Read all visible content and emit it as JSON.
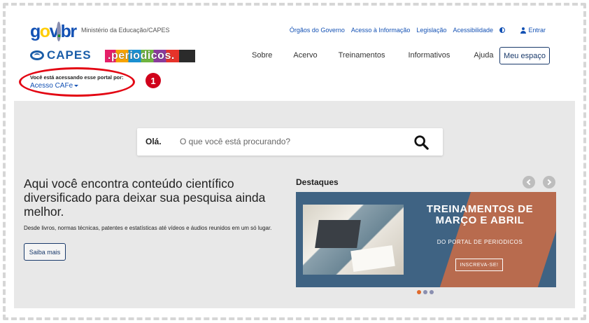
{
  "header": {
    "govbr_logo": "gov.br",
    "ministry": "Ministério da Educação/CAPES",
    "top_links": [
      "Órgãos do Governo",
      "Acesso à Informação",
      "Legislação",
      "Acessibilidade"
    ],
    "login": "Entrar"
  },
  "brand": {
    "capes": "CAPES",
    "periodicos": ".periodicos."
  },
  "nav": {
    "items": [
      "Sobre",
      "Acervo",
      "Treinamentos",
      "Informativos",
      "Ajuda"
    ],
    "my_space": "Meu espaço"
  },
  "access": {
    "label": "Você está acessando esse portal por:",
    "value": "Acesso CAFe",
    "annotation_number": "1"
  },
  "search": {
    "greeting": "Olá.",
    "placeholder": "O que você está procurando?"
  },
  "hero": {
    "headline": "Aqui você encontra conteúdo científico diversificado para deixar sua pesquisa ainda melhor.",
    "subtext": "Desde livros, normas técnicas, patentes e estatísticas até vídeos e áudios reunidos em um só lugar.",
    "cta": "Saiba mais"
  },
  "highlights": {
    "title": "Destaques",
    "banner_title": "TREINAMENTOS DE MARÇO E ABRIL",
    "banner_sub": "DO PORTAL DE PERIODICOS",
    "banner_button": "INSCREVA-SE!",
    "slide_count": 3,
    "active_slide": 1
  },
  "colors": {
    "primary_blue": "#1351b4",
    "annotation_red": "#e30613",
    "hero_bg": "#e8e8e8",
    "banner_blue": "#3f6383",
    "banner_orange": "#b86b4e"
  }
}
